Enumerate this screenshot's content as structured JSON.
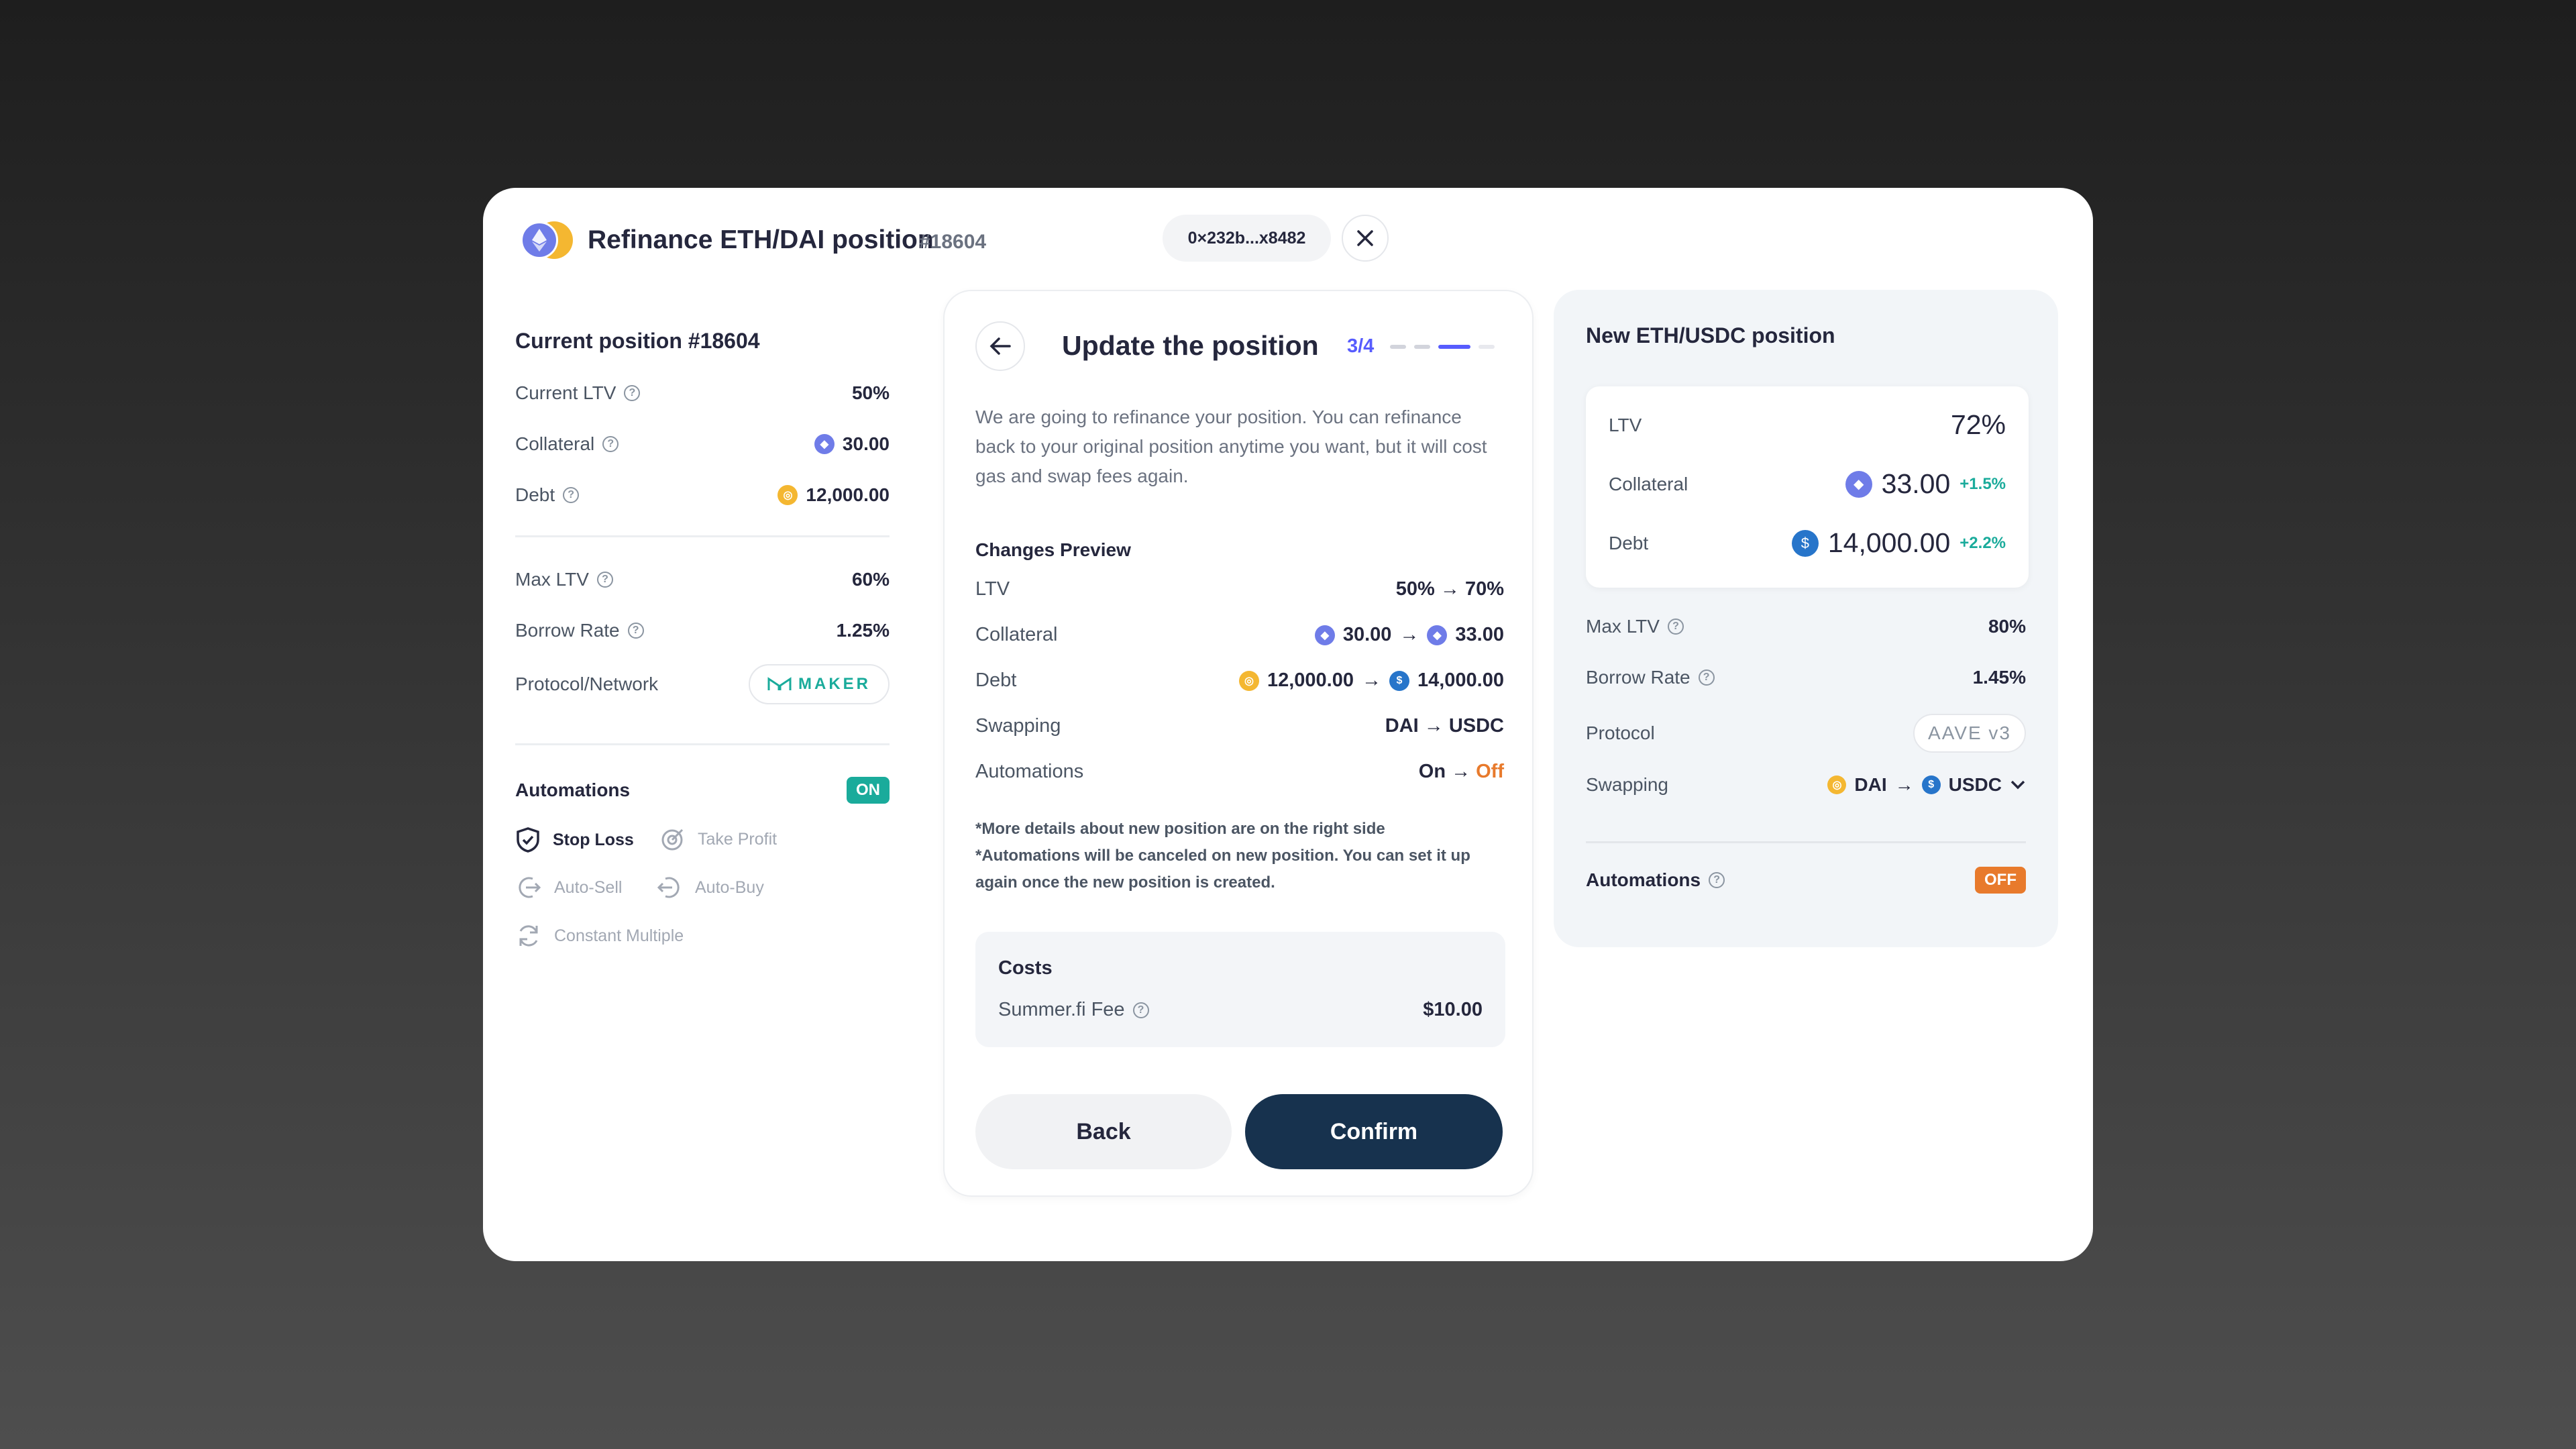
{
  "header": {
    "title": "Refinance ETH/DAI position",
    "position_id": "#18604",
    "address": "0×232b...x8482"
  },
  "current": {
    "title": "Current position #18604",
    "rows1": [
      {
        "label": "Current LTV",
        "value": "50%"
      },
      {
        "label": "Collateral",
        "value": "30.00"
      },
      {
        "label": "Debt",
        "value": "12,000.00"
      }
    ],
    "rows2": [
      {
        "label": "Max LTV",
        "value": "60%"
      },
      {
        "label": "Borrow Rate",
        "value": "1.25%"
      },
      {
        "label": "Protocol/Network",
        "value": "MAKER"
      }
    ],
    "automations": {
      "label": "Automations",
      "status": "ON",
      "items": [
        "Stop Loss",
        "Take Profit",
        "Auto-Sell",
        "Auto-Buy",
        "Constant Multiple"
      ]
    }
  },
  "update": {
    "title": "Update the position",
    "step": "3/4",
    "description": "We are going to refinance your position. You can refinance back to your original position anytime you want, but it will cost gas and swap fees again.",
    "changes_title": "Changes Preview",
    "changes": {
      "ltv": {
        "label": "LTV",
        "value": "50% → 70%"
      },
      "collateral": {
        "label": "Collateral",
        "from": "30.00",
        "to": "33.00"
      },
      "debt": {
        "label": "Debt",
        "from": "12,000.00",
        "to": "14,000.00"
      },
      "swapping": {
        "label": "Swapping",
        "value": "DAI → USDC"
      },
      "automations": {
        "label": "Automations",
        "from": "On →",
        "to": "Off"
      }
    },
    "note1": "*More details about new position are on the right side",
    "note2": "*Automations will be canceled on new position. You can set it up again once the new position is created.",
    "costs": {
      "title": "Costs",
      "fee_label": "Summer.fi Fee",
      "fee_value": "$10.00"
    },
    "back_label": "Back",
    "confirm_label": "Confirm"
  },
  "new_position": {
    "title": "New ETH/USDC position",
    "ltv": {
      "label": "LTV",
      "value": "72%"
    },
    "collateral": {
      "label": "Collateral",
      "value": "33.00",
      "change": "+1.5%"
    },
    "debt": {
      "label": "Debt",
      "value": "14,000.00",
      "change": "+2.2%"
    },
    "max_ltv": {
      "label": "Max LTV",
      "value": "80%"
    },
    "borrow_rate": {
      "label": "Borrow Rate",
      "value": "1.45%"
    },
    "protocol": {
      "label": "Protocol",
      "value": "AAVE v3"
    },
    "swapping": {
      "label": "Swapping",
      "from": "DAI",
      "to": "USDC"
    },
    "automations": {
      "label": "Automations",
      "status": "OFF"
    }
  },
  "colors": {
    "accent": "#575cfe",
    "teal": "#1aab9b",
    "orange": "#e87a2c",
    "navy": "#17324e",
    "eth": "#6f7ce8",
    "dai": "#f4b731",
    "usdc": "#2775ca"
  }
}
